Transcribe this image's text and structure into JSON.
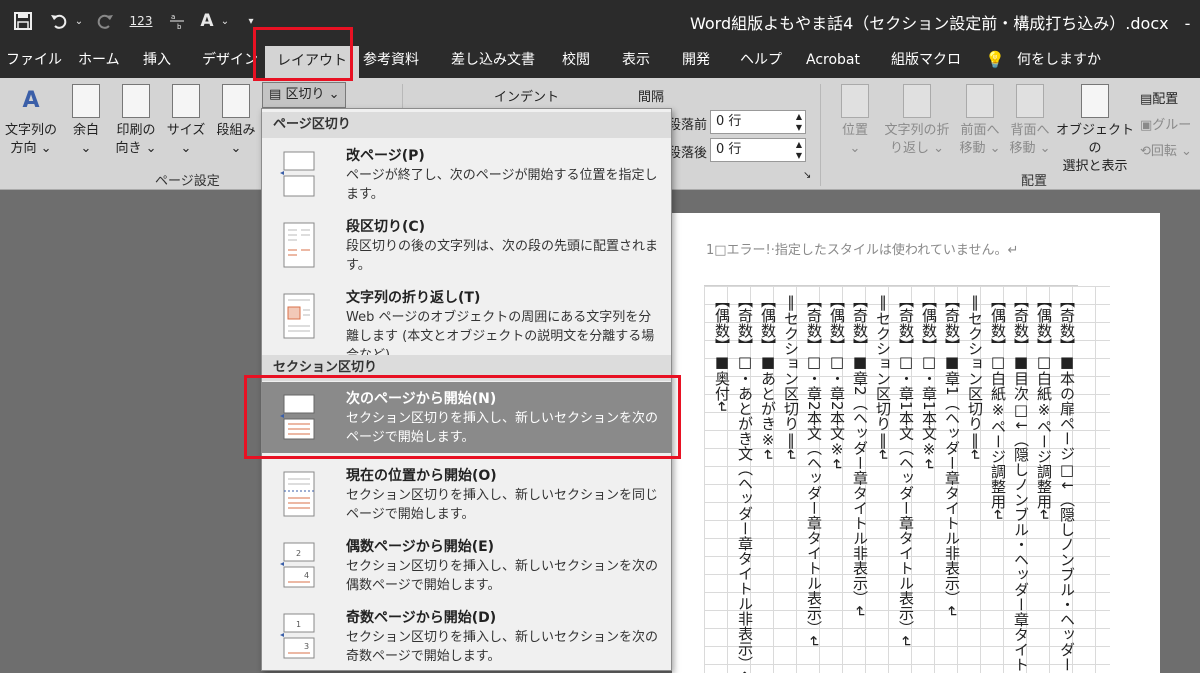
{
  "window": {
    "title": "Word組版よもやま話4（セクション設定前・構成打ち込み）.docx　-　Word"
  },
  "qat": {
    "undo_label": "123",
    "abc_label": "A"
  },
  "tabs": [
    {
      "label": "ファイル"
    },
    {
      "label": "ホーム"
    },
    {
      "label": "挿入"
    },
    {
      "label": "デザイン"
    },
    {
      "label": "レイアウト"
    },
    {
      "label": "参考資料"
    },
    {
      "label": "差し込み文書"
    },
    {
      "label": "校閲"
    },
    {
      "label": "表示"
    },
    {
      "label": "開発"
    },
    {
      "label": "ヘルプ"
    },
    {
      "label": "Acrobat"
    },
    {
      "label": "組版マクロ"
    }
  ],
  "tell_me": "何をしますか",
  "ribbon": {
    "text_direction": [
      "文字列の",
      "方向"
    ],
    "margins": "余白",
    "orientation": [
      "印刷の",
      "向き"
    ],
    "size": "サイズ",
    "columns": [
      "段組み"
    ],
    "breaks": "区切り",
    "page_setup_group": "ページ設定",
    "indent_label": "インデント",
    "spacing_label": "間隔",
    "spacing_before_label": "段落前",
    "spacing_before_value": "0 行",
    "spacing_after_label": "段落後",
    "spacing_after_value": "0 行",
    "position": "位置",
    "wrap_text": [
      "文字列の折",
      "り返し"
    ],
    "bring_forward": [
      "前面へ",
      "移動"
    ],
    "send_backward": [
      "背面へ",
      "移動"
    ],
    "selection_pane": [
      "オブジェクトの",
      "選択と表示"
    ],
    "align": "配置",
    "group": "グルー",
    "rotate": "回転",
    "arrange_group": "配置"
  },
  "menu": {
    "page_breaks_header": "ページ区切り",
    "section_breaks_header": "セクション区切り",
    "items": [
      {
        "title": "改ページ(P)",
        "desc": "ページが終了し、次のページが開始する位置を指定します。"
      },
      {
        "title": "段区切り(C)",
        "desc": "段区切りの後の文字列は、次の段の先頭に配置されます。"
      },
      {
        "title": "文字列の折り返し(T)",
        "desc": "Web ページのオブジェクトの周囲にある文字列を分離します (本文とオブジェクトの説明文を分離する場合など)。"
      },
      {
        "title": "次のページから開始(N)",
        "desc": "セクション区切りを挿入し、新しいセクションを次のページで開始します。"
      },
      {
        "title": "現在の位置から開始(O)",
        "desc": "セクション区切りを挿入し、新しいセクションを同じページで開始します。"
      },
      {
        "title": "偶数ページから開始(E)",
        "desc": "セクション区切りを挿入し、新しいセクションを次の偶数ページで開始します。"
      },
      {
        "title": "奇数ページから開始(D)",
        "desc": "セクション区切りを挿入し、新しいセクションを次の奇数ページで開始します。"
      }
    ],
    "icon_nums": {
      "even_top": "2",
      "even_bottom": "4",
      "odd_top": "1",
      "odd_bottom": "3"
    }
  },
  "document": {
    "header_text": "1□エラー!·指定したスタイルは使われていません。↵",
    "columns": [
      "【奇数】■本の扉ページ□↓（隠しノンブル・ヘッダー",
      "【偶数】□白紙※ページ調整用↵",
      "【奇数】■目次□↓（隠しノンブル・ヘッダー章タイト",
      "【偶数】□白紙※ページ調整用↵",
      "‖セクション区切り‖↵",
      "【奇数】■章1（ヘッダー章タイトル非表示）↵",
      "【偶数】□・章1本文※↵",
      "【奇数】□・章1本文（ヘッダー章タイトル表示）↵",
      "‖セクション区切り‖↵",
      "【奇数】■章2（ヘッダー章タイトル非表示）↵",
      "【偶数】□・章2本文※↵",
      "【奇数】□・章2本文（ヘッダー章タイトル表示）↵",
      "‖セクション区切り‖↵",
      "【偶数】■あとがき※↵",
      "【奇数】□・あとがき文（ヘッダー章タイトル非表示）↵",
      "【偶数】■奥付↵"
    ]
  }
}
